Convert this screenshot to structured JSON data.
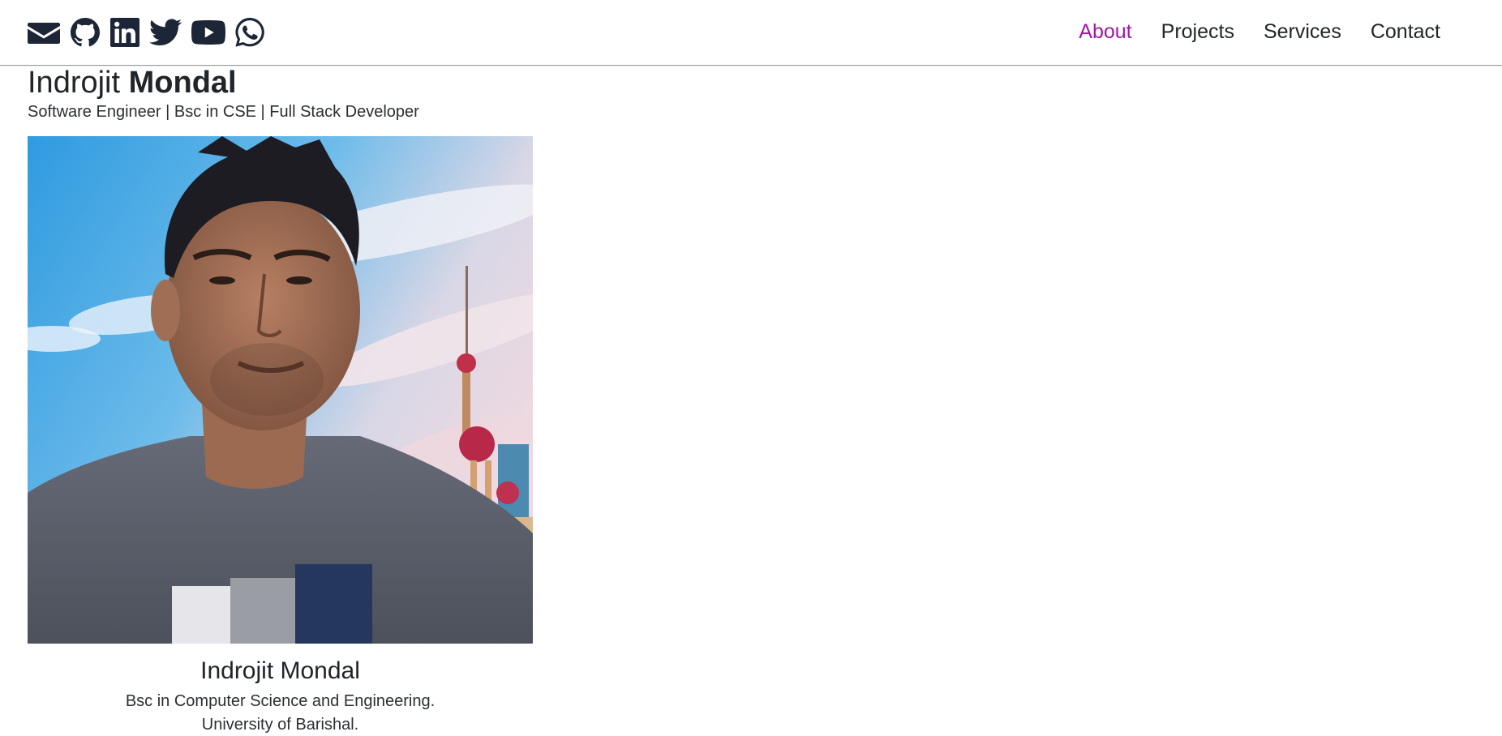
{
  "social": [
    {
      "name": "email",
      "icon": "envelope-icon"
    },
    {
      "name": "github",
      "icon": "github-icon"
    },
    {
      "name": "linkedin",
      "icon": "linkedin-icon"
    },
    {
      "name": "twitter",
      "icon": "twitter-icon"
    },
    {
      "name": "youtube",
      "icon": "youtube-icon"
    },
    {
      "name": "whatsapp",
      "icon": "whatsapp-icon"
    }
  ],
  "nav": {
    "items": [
      {
        "label": "About",
        "active": true
      },
      {
        "label": "Projects",
        "active": false
      },
      {
        "label": "Services",
        "active": false
      },
      {
        "label": "Contact",
        "active": false
      }
    ],
    "active_color": "#a017a8"
  },
  "header": {
    "first_name": "Indrojit",
    "last_name": "Mondal",
    "subtitle": "Software Engineer | Bsc in CSE | Full Stack Developer"
  },
  "profile": {
    "name": "Indrojit Mondal",
    "degree": "Bsc in Computer Science and Engineering.",
    "university": "University of Barishal."
  }
}
